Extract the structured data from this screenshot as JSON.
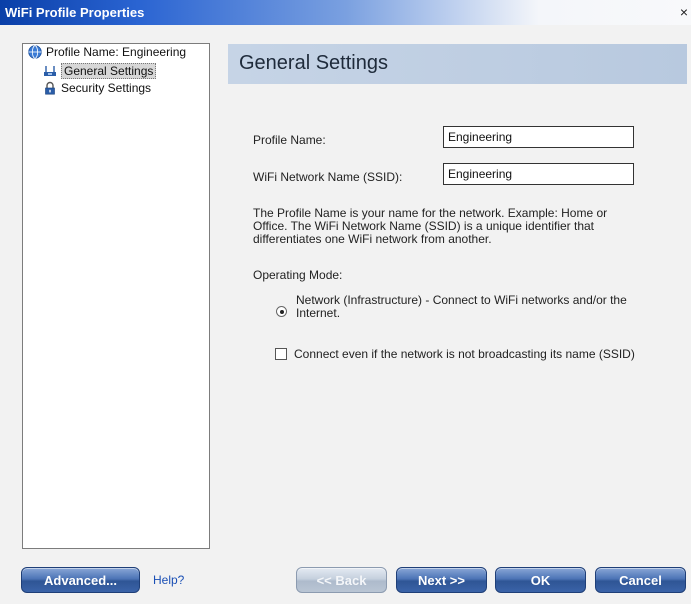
{
  "window": {
    "title": "WiFi Profile Properties",
    "close_glyph": "×"
  },
  "tree": {
    "root_label": "Profile Name: Engineering",
    "items": [
      {
        "label": "General Settings",
        "icon": "network-icon",
        "selected": true
      },
      {
        "label": "Security Settings",
        "icon": "lock-icon",
        "selected": false
      }
    ]
  },
  "panel": {
    "heading": "General Settings",
    "profile_name_label": "Profile Name:",
    "profile_name_value": "Engineering",
    "ssid_label": "WiFi Network Name (SSID):",
    "ssid_value": "Engineering",
    "description": "The Profile Name is your name for the network. Example: Home or Office. The WiFi Network Name (SSID) is a unique identifier that differentiates one WiFi network from another.",
    "operating_mode_label": "Operating Mode:",
    "radio_label": "Network (Infrastructure) - Connect to WiFi networks and/or the Internet.",
    "checkbox_label": "Connect even if the network is not broadcasting its name (SSID)"
  },
  "buttons": {
    "advanced": "Advanced...",
    "help": "Help?",
    "back": "<< Back",
    "next": "Next >>",
    "ok": "OK",
    "cancel": "Cancel"
  },
  "colors": {
    "button_blue": "#3a63a8",
    "header_band": "#c6d4e6",
    "titlebar_blue": "#0a3fa8"
  }
}
